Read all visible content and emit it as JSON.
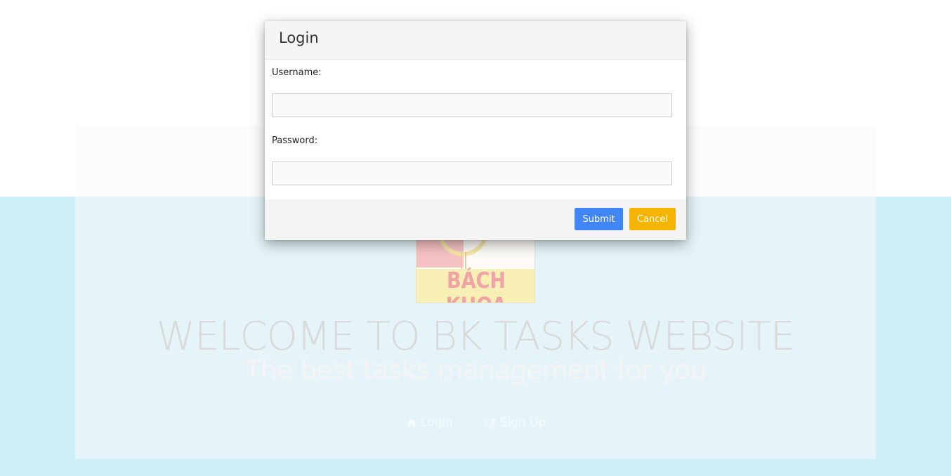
{
  "modal": {
    "title": "Login",
    "username_label": "Username:",
    "username_value": "",
    "password_label": "Password:",
    "password_value": "",
    "submit_label": "Submit",
    "cancel_label": "Cancel"
  },
  "hero": {
    "logo_text": "BÁCH KHOA",
    "title": "WELCOME TO BK TASKS WEBSITE",
    "subtitle": "The best tasks management for you",
    "login_label": "Login",
    "signup_label": "Sign Up"
  },
  "colors": {
    "submit": "#4285f4",
    "cancel": "#f4b400",
    "background_band": "#cbeef7"
  }
}
